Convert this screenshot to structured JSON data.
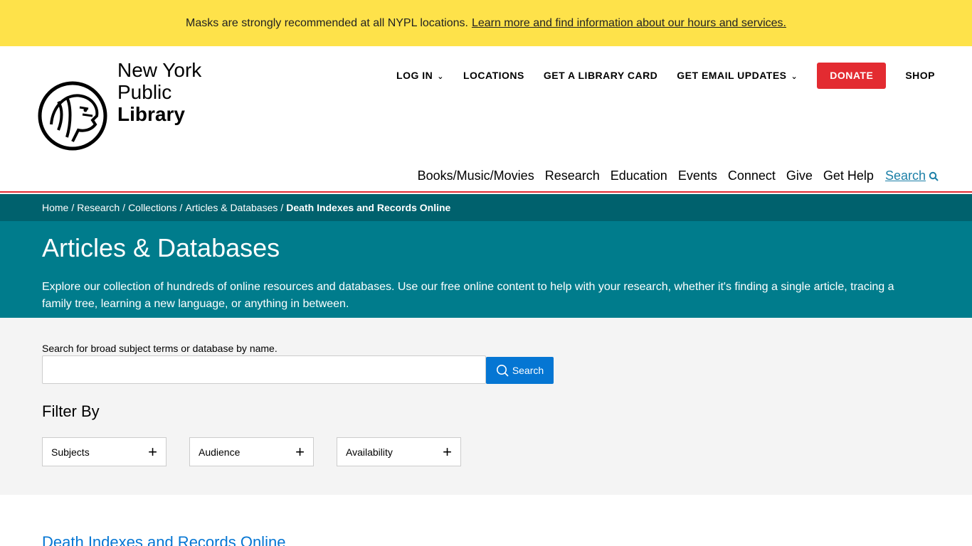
{
  "alert": {
    "text": "Masks are strongly recommended at all NYPL locations.",
    "link": "Learn more and find information about our hours and services."
  },
  "logo": {
    "line1": "New York",
    "line2": "Public",
    "line3": "Library",
    "icon": "lion-icon"
  },
  "utility_nav": {
    "login": "LOG IN",
    "locations": "LOCATIONS",
    "library_card": "GET A LIBRARY CARD",
    "email_updates": "GET EMAIL UPDATES",
    "donate": "DONATE",
    "shop": "SHOP"
  },
  "main_nav": {
    "items": [
      "Books/Music/Movies",
      "Research",
      "Education",
      "Events",
      "Connect",
      "Give",
      "Get Help"
    ],
    "search": "Search"
  },
  "breadcrumb": {
    "items": [
      "Home",
      "Research",
      "Collections",
      "Articles & Databases"
    ],
    "current": "Death Indexes and Records Online"
  },
  "hero": {
    "title": "Articles & Databases",
    "description": "Explore our collection of hundreds of online resources and databases. Use our free online content to help with your research, whether it's finding a single article, tracing a family tree, learning a new language, or anything in between."
  },
  "search": {
    "label": "Search for broad subject terms or database by name.",
    "value": "",
    "button": "Search"
  },
  "filters": {
    "heading": "Filter By",
    "items": [
      "Subjects",
      "Audience",
      "Availability"
    ]
  },
  "result": {
    "title": "Death Indexes and Records Online"
  },
  "colors": {
    "alert_bg": "#fee24a",
    "brand_red": "#e32b31",
    "breadcrumb_bg": "#00616d",
    "hero_bg": "#007c8c",
    "button_blue": "#0576d3"
  }
}
